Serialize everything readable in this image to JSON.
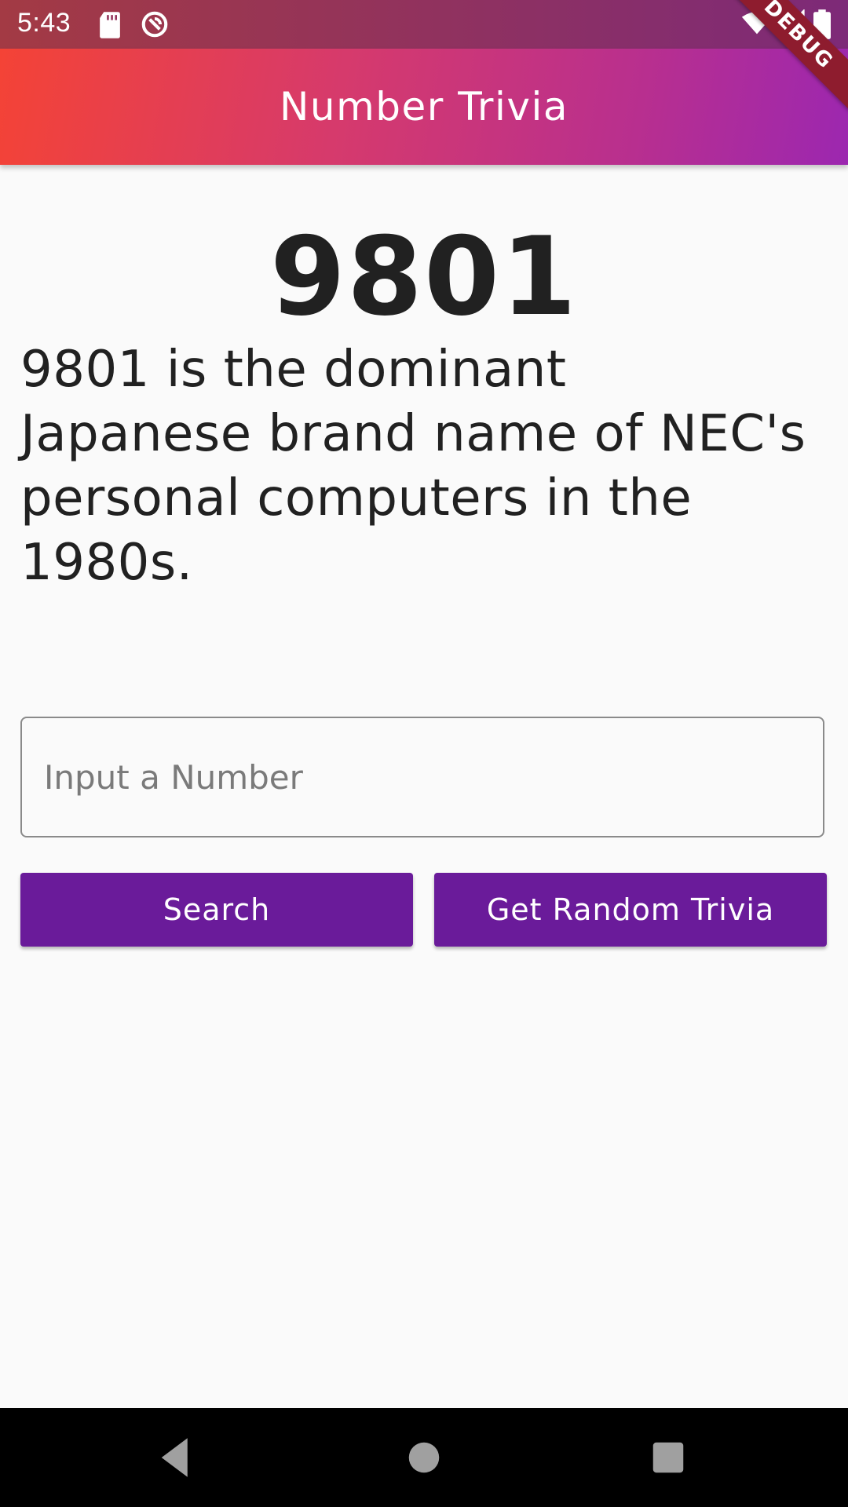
{
  "status_bar": {
    "time": "5:43",
    "left_icons": [
      "sd-card-icon",
      "sync-disabled-icon"
    ],
    "right_icons": [
      "wifi-icon",
      "cell-signal-icon",
      "battery-icon"
    ]
  },
  "app_bar": {
    "title": "Number Trivia"
  },
  "debug_banner": {
    "label": "DEBUG"
  },
  "trivia": {
    "number": "9801",
    "text": "9801 is the dominant Japanese brand name of NEC's personal computers in the 1980s."
  },
  "input": {
    "placeholder": "Input a Number",
    "value": ""
  },
  "buttons": {
    "search_label": "Search",
    "random_label": "Get Random Trivia"
  },
  "nav_bar": {
    "icons": [
      "back-icon",
      "home-icon",
      "recents-icon"
    ]
  },
  "colors": {
    "app_bar_gradient_start": "#f44336",
    "app_bar_gradient_end": "#9c27b0",
    "button": "#6a1b9a",
    "text": "#212121",
    "background": "#fafafa"
  }
}
